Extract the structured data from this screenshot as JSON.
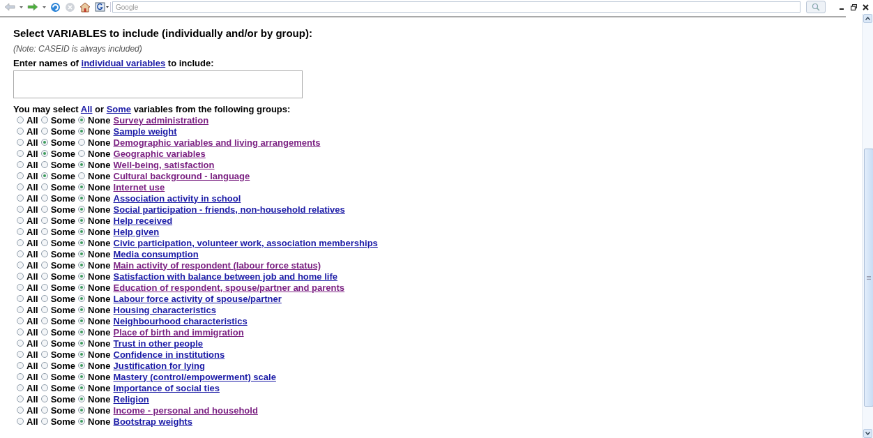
{
  "toolbar": {
    "search": {
      "placeholder": "Google"
    }
  },
  "heading": "Select VARIABLES to include (individually and/or by group):",
  "note": "(Note: CASEID is always included)",
  "individual": {
    "prefix": "Enter names of ",
    "link": "individual variables",
    "suffix": " to include:"
  },
  "groups_intro": {
    "prefix": "You may select ",
    "link_all": "All",
    "middle": " or ",
    "link_some": "Some",
    "suffix": " variables from the following groups:"
  },
  "groups": [
    {
      "name": "Survey administration",
      "visited": true,
      "options": [
        {
          "label": "All",
          "selected": false
        },
        {
          "label": "Some",
          "selected": false
        },
        {
          "label": "None",
          "selected": true
        }
      ]
    },
    {
      "name": "Sample weight",
      "visited": false,
      "options": [
        {
          "label": "All",
          "selected": false
        },
        {
          "label": "Some",
          "selected": false
        },
        {
          "label": "None",
          "selected": true
        }
      ]
    },
    {
      "name": "Demographic variables and living arrangements",
      "visited": true,
      "options": [
        {
          "label": "All",
          "selected": false
        },
        {
          "label": "Some",
          "selected": true
        },
        {
          "label": "None",
          "selected": false
        }
      ]
    },
    {
      "name": "Geographic variables",
      "visited": true,
      "options": [
        {
          "label": "All",
          "selected": false
        },
        {
          "label": "Some",
          "selected": true
        },
        {
          "label": "None",
          "selected": false
        }
      ]
    },
    {
      "name": "Well-being, satisfaction",
      "visited": true,
      "options": [
        {
          "label": "All",
          "selected": false
        },
        {
          "label": "Some",
          "selected": false
        },
        {
          "label": "None",
          "selected": true
        }
      ]
    },
    {
      "name": "Cultural background - language",
      "visited": true,
      "options": [
        {
          "label": "All",
          "selected": false
        },
        {
          "label": "Some",
          "selected": true
        },
        {
          "label": "None",
          "selected": false
        }
      ]
    },
    {
      "name": "Internet use",
      "visited": true,
      "options": [
        {
          "label": "All",
          "selected": false
        },
        {
          "label": "Some",
          "selected": false
        },
        {
          "label": "None",
          "selected": true
        }
      ]
    },
    {
      "name": "Association activity in school",
      "visited": false,
      "options": [
        {
          "label": "All",
          "selected": false
        },
        {
          "label": "Some",
          "selected": false
        },
        {
          "label": "None",
          "selected": true
        }
      ]
    },
    {
      "name": "Social participation - friends, non-household relatives",
      "visited": false,
      "options": [
        {
          "label": "All",
          "selected": false
        },
        {
          "label": "Some",
          "selected": false
        },
        {
          "label": "None",
          "selected": true
        }
      ]
    },
    {
      "name": "Help received",
      "visited": false,
      "options": [
        {
          "label": "All",
          "selected": false
        },
        {
          "label": "Some",
          "selected": false
        },
        {
          "label": "None",
          "selected": true
        }
      ]
    },
    {
      "name": "Help given",
      "visited": false,
      "options": [
        {
          "label": "All",
          "selected": false
        },
        {
          "label": "Some",
          "selected": false
        },
        {
          "label": "None",
          "selected": true
        }
      ]
    },
    {
      "name": "Civic participation, volunteer work, association memberships",
      "visited": false,
      "options": [
        {
          "label": "All",
          "selected": false
        },
        {
          "label": "Some",
          "selected": false
        },
        {
          "label": "None",
          "selected": true
        }
      ]
    },
    {
      "name": "Media consumption",
      "visited": false,
      "options": [
        {
          "label": "All",
          "selected": false
        },
        {
          "label": "Some",
          "selected": false
        },
        {
          "label": "None",
          "selected": true
        }
      ]
    },
    {
      "name": "Main activity of respondent (labour force status)",
      "visited": true,
      "options": [
        {
          "label": "All",
          "selected": false
        },
        {
          "label": "Some",
          "selected": false
        },
        {
          "label": "None",
          "selected": true
        }
      ]
    },
    {
      "name": "Satisfaction with balance between job and home life",
      "visited": false,
      "options": [
        {
          "label": "All",
          "selected": false
        },
        {
          "label": "Some",
          "selected": false
        },
        {
          "label": "None",
          "selected": true
        }
      ]
    },
    {
      "name": "Education of respondent, spouse/partner and parents",
      "visited": true,
      "options": [
        {
          "label": "All",
          "selected": false
        },
        {
          "label": "Some",
          "selected": false
        },
        {
          "label": "None",
          "selected": true
        }
      ]
    },
    {
      "name": "Labour force activity of spouse/partner",
      "visited": false,
      "options": [
        {
          "label": "All",
          "selected": false
        },
        {
          "label": "Some",
          "selected": false
        },
        {
          "label": "None",
          "selected": true
        }
      ]
    },
    {
      "name": "Housing characteristics",
      "visited": false,
      "options": [
        {
          "label": "All",
          "selected": false
        },
        {
          "label": "Some",
          "selected": false
        },
        {
          "label": "None",
          "selected": true
        }
      ]
    },
    {
      "name": "Neighbourhood characteristics",
      "visited": false,
      "options": [
        {
          "label": "All",
          "selected": false
        },
        {
          "label": "Some",
          "selected": false
        },
        {
          "label": "None",
          "selected": true
        }
      ]
    },
    {
      "name": "Place of birth and immigration",
      "visited": true,
      "options": [
        {
          "label": "All",
          "selected": false
        },
        {
          "label": "Some",
          "selected": false
        },
        {
          "label": "None",
          "selected": true
        }
      ]
    },
    {
      "name": "Trust in other people",
      "visited": false,
      "options": [
        {
          "label": "All",
          "selected": false
        },
        {
          "label": "Some",
          "selected": false
        },
        {
          "label": "None",
          "selected": true
        }
      ]
    },
    {
      "name": "Confidence in institutions",
      "visited": false,
      "options": [
        {
          "label": "All",
          "selected": false
        },
        {
          "label": "Some",
          "selected": false
        },
        {
          "label": "None",
          "selected": true
        }
      ]
    },
    {
      "name": "Justification for lying",
      "visited": false,
      "options": [
        {
          "label": "All",
          "selected": false
        },
        {
          "label": "Some",
          "selected": false
        },
        {
          "label": "None",
          "selected": true
        }
      ]
    },
    {
      "name": "Mastery (control/empowerment) scale",
      "visited": false,
      "options": [
        {
          "label": "All",
          "selected": false
        },
        {
          "label": "Some",
          "selected": false
        },
        {
          "label": "None",
          "selected": true
        }
      ]
    },
    {
      "name": "Importance of social ties",
      "visited": false,
      "options": [
        {
          "label": "All",
          "selected": false
        },
        {
          "label": "Some",
          "selected": false
        },
        {
          "label": "None",
          "selected": true
        }
      ]
    },
    {
      "name": "Religion",
      "visited": false,
      "options": [
        {
          "label": "All",
          "selected": false
        },
        {
          "label": "Some",
          "selected": false
        },
        {
          "label": "None",
          "selected": true
        }
      ]
    },
    {
      "name": "Income - personal and household",
      "visited": true,
      "options": [
        {
          "label": "All",
          "selected": false
        },
        {
          "label": "Some",
          "selected": false
        },
        {
          "label": "None",
          "selected": true
        }
      ]
    },
    {
      "name": "Bootstrap weights",
      "visited": false,
      "options": [
        {
          "label": "All",
          "selected": false
        },
        {
          "label": "Some",
          "selected": false
        },
        {
          "label": "None",
          "selected": true
        }
      ]
    }
  ]
}
